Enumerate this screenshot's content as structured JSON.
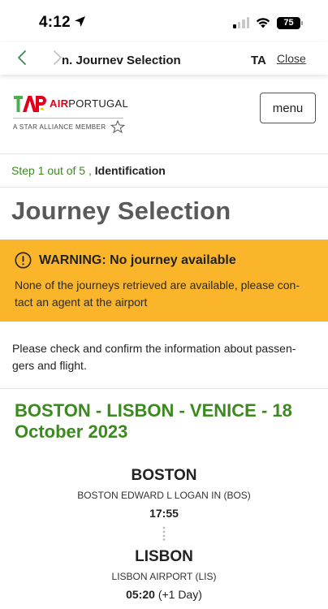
{
  "status_bar": {
    "time": "4:12",
    "battery": "75"
  },
  "browser": {
    "title": "n. Journev Selection",
    "ta": "TA",
    "close": "Close"
  },
  "header": {
    "logo_tap": "TAP",
    "logo_air": "AIR",
    "logo_portugal": "PORTUGAL",
    "alliance": "A STAR ALLIANCE MEMBER",
    "menu_label": "menu",
    "brand_color": "#e3001b",
    "brand_green": "#3a8a1e"
  },
  "step": {
    "progress": "Step 1 out of 5 ,",
    "name": "Identification"
  },
  "page": {
    "title": "Journey Selection"
  },
  "warning": {
    "title": "WARNING: No journey available",
    "text": "None of the journeys retrieved are available, please con-tact an agent at the airport",
    "color": "#fbb52a"
  },
  "info": {
    "text": "Please check and confirm the information about passen-gers and flight."
  },
  "journey": {
    "route": "BOSTON - LISBON - VENICE - 18 October 2023",
    "stops": [
      {
        "city": "BOSTON",
        "airport": "BOSTON EDWARD L LOGAN IN (BOS)",
        "time": "17:55",
        "day": ""
      },
      {
        "city": "LISBON",
        "airport": "LISBON AIRPORT (LIS)",
        "time": "05:20",
        "day": "(+1 Day)"
      }
    ]
  }
}
